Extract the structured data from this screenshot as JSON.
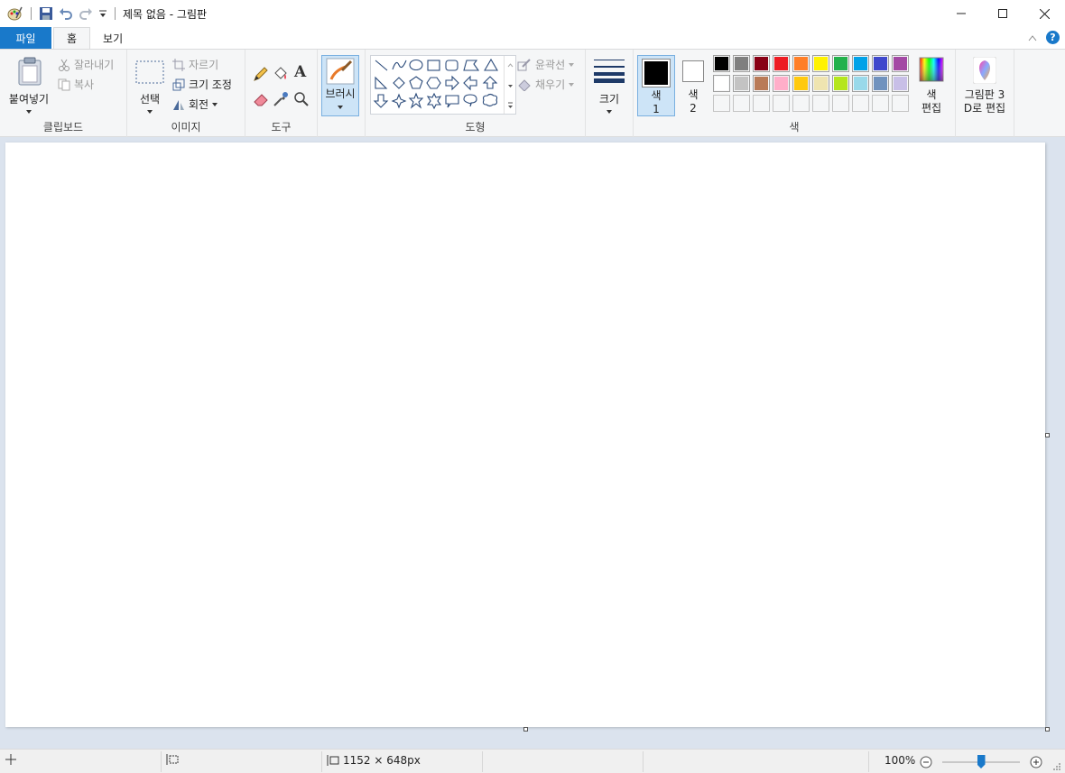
{
  "window": {
    "title": "제목 없음 - 그림판",
    "minimize_icon": "minimize-icon",
    "maximize_icon": "maximize-icon",
    "close_icon": "close-icon"
  },
  "tabs": [
    {
      "label": "파일"
    },
    {
      "label": "홈"
    },
    {
      "label": "보기"
    }
  ],
  "ribbon": {
    "clipboard": {
      "label": "클립보드",
      "paste": "붙여넣기",
      "cut": "잘라내기",
      "copy": "복사"
    },
    "image": {
      "label": "이미지",
      "select": "선택",
      "crop": "자르기",
      "resize": "크기 조정",
      "rotate": "회전"
    },
    "tools": {
      "label": "도구"
    },
    "brushes": {
      "label": "브러시"
    },
    "shapes": {
      "label": "도형",
      "outline": "윤곽선",
      "fill": "채우기"
    },
    "size": {
      "label": "크기"
    },
    "colors": {
      "label": "색",
      "color1_label": "색",
      "color1_num": "1",
      "color2_label": "색",
      "color2_num": "2",
      "edit_colors_1": "색",
      "edit_colors_2": "편집",
      "color1": "#000000",
      "color2": "#ffffff",
      "palette_row1": [
        "#000000",
        "#7f7f7f",
        "#880015",
        "#ed1c24",
        "#ff7f27",
        "#fff200",
        "#22b14c",
        "#00a2e8",
        "#3f48cc",
        "#a349a4"
      ],
      "palette_row2": [
        "#ffffff",
        "#c3c3c3",
        "#b97a57",
        "#ffaec9",
        "#ffc90e",
        "#efe4b0",
        "#b5e61d",
        "#99d9ea",
        "#7092be",
        "#c8bfe7"
      ]
    },
    "paint3d": {
      "line1": "그림판 3",
      "line2": "D로 편집"
    }
  },
  "status": {
    "canvas_size": "1152 × 648px",
    "zoom": "100%",
    "zoom_level": 1.0
  }
}
